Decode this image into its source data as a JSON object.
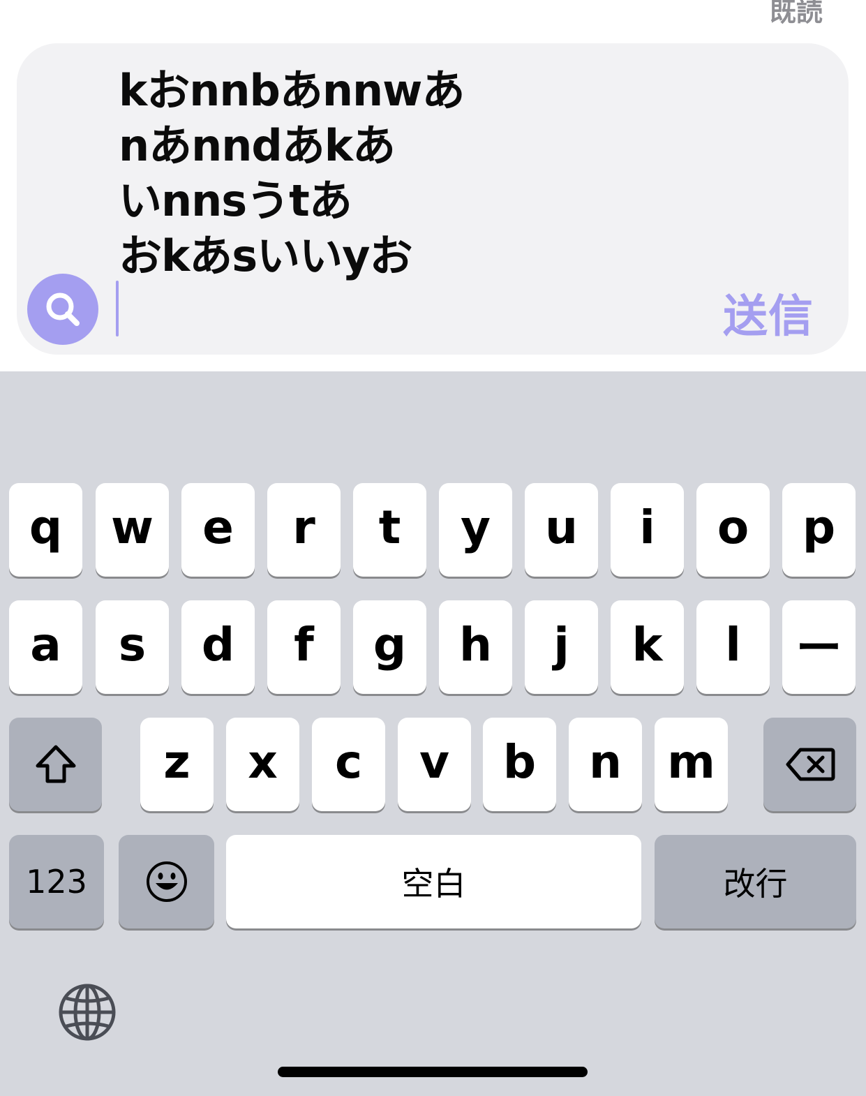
{
  "header": {
    "read_status": "既読"
  },
  "composer": {
    "message_lines": [
      "kおnnbあnnwあ",
      "nあnndあkあ",
      "いnnsうtあ",
      "おkあsいいyお"
    ],
    "send_label": "送信",
    "search_icon": "search-icon",
    "accent_color": "#a49ef0"
  },
  "keyboard": {
    "row1": [
      "q",
      "w",
      "e",
      "r",
      "t",
      "y",
      "u",
      "i",
      "o",
      "p"
    ],
    "row2": [
      "a",
      "s",
      "d",
      "f",
      "g",
      "h",
      "j",
      "k",
      "l",
      "ー"
    ],
    "row3": [
      "z",
      "x",
      "c",
      "v",
      "b",
      "n",
      "m"
    ],
    "shift_icon": "shift-arrow-icon",
    "delete_icon": "delete-backspace-icon",
    "numbers_label": "123",
    "emoji_icon": "emoji-smile-icon",
    "space_label": "空白",
    "return_label": "改行",
    "globe_icon": "globe-icon"
  }
}
